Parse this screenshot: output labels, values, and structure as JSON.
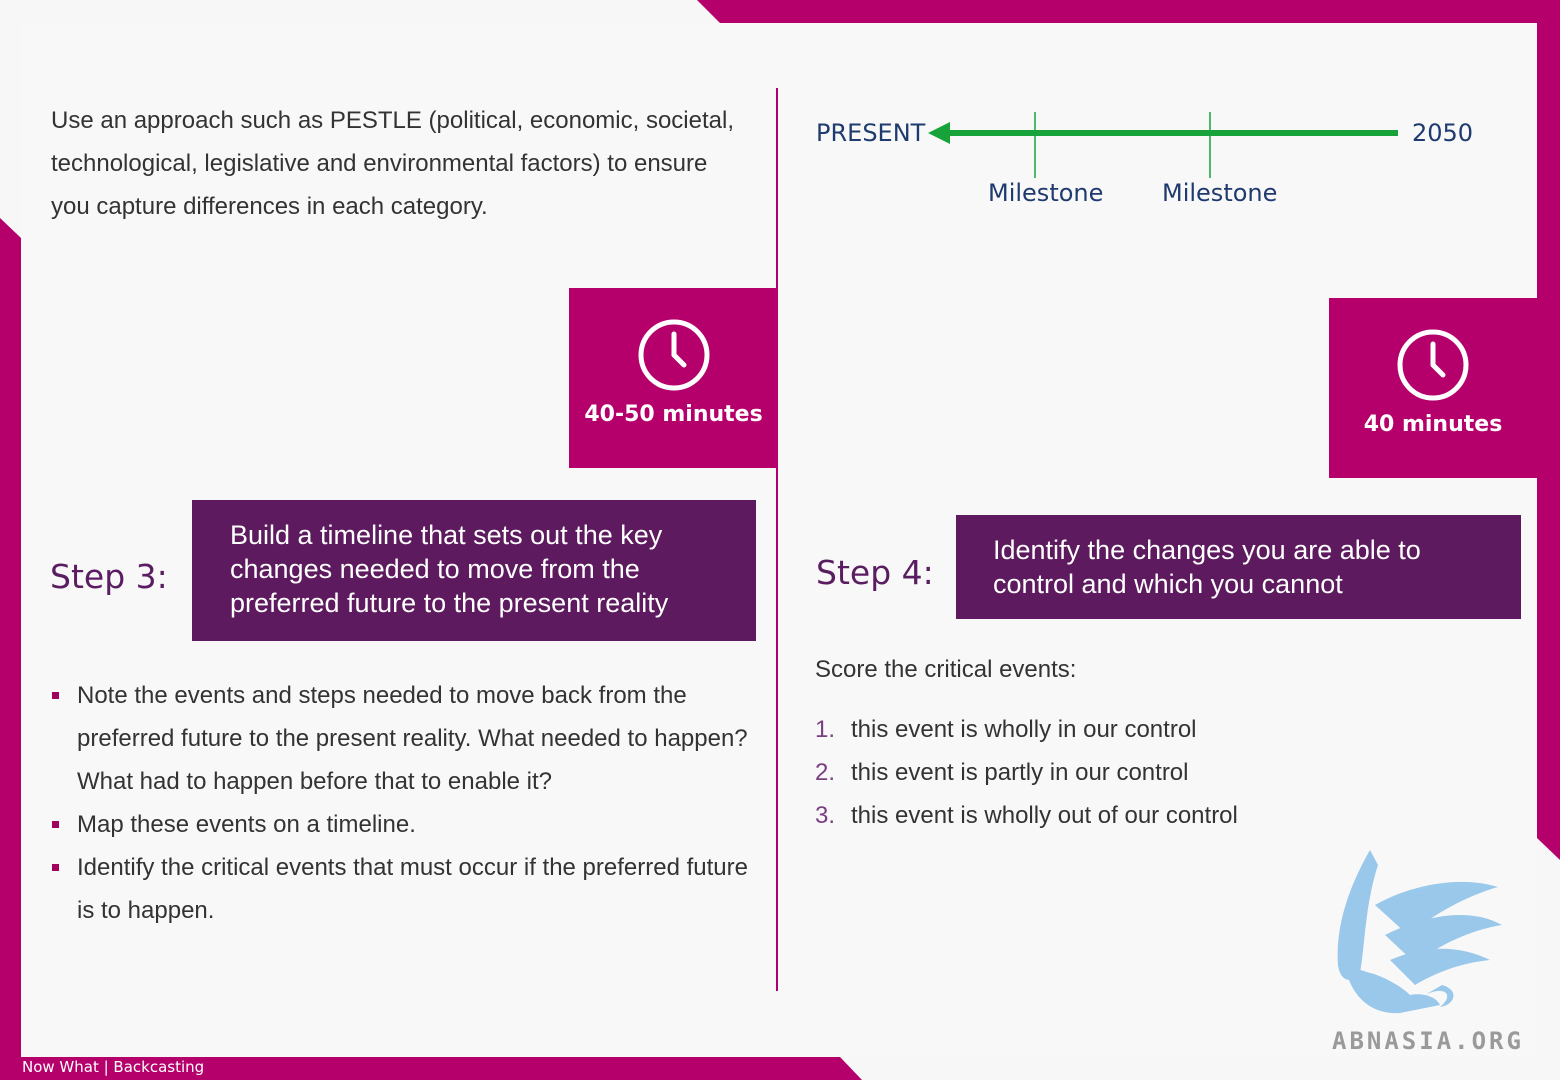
{
  "intro_text": "Use an approach such as PESTLE (political, economic, societal, technological, legislative and environmental factors) to ensure you capture differences in each category.",
  "step3": {
    "time": "40-50 minutes",
    "label": "Step 3:",
    "title": "Build a timeline that sets out the key changes needed to move from the preferred future to the present reality",
    "bullets": [
      "Note the events and steps needed to move back from the preferred future to the present reality. What needed to happen? What had to happen before that to enable it?",
      "Map these events on a timeline.",
      "Identify the critical events that must occur if the preferred future is to happen."
    ]
  },
  "timeline": {
    "start_label": "PRESENT",
    "end_label": "2050",
    "milestones": [
      "Milestone",
      "Milestone"
    ],
    "arrow_color": "#18a33a"
  },
  "step4": {
    "time": "40 minutes",
    "label": "Step 4:",
    "title": "Identify the changes you are able to control and which you cannot",
    "score_title": "Score the critical events:",
    "score_items": [
      {
        "num": "1.",
        "text": "this event is wholly in our control"
      },
      {
        "num": "2.",
        "text": "this event is partly in our control"
      },
      {
        "num": "3.",
        "text": "this event is wholly out of our control"
      }
    ]
  },
  "logo_text": "ABNASIA.ORG",
  "footer": "Now What | Backcasting",
  "colors": {
    "magenta": "#b5006c",
    "purple": "#5d1a5e",
    "step_text": "#5a1d61",
    "timeline_text": "#1f3a6e"
  },
  "icons": [
    "clock-icon",
    "griffin-logo-icon"
  ]
}
